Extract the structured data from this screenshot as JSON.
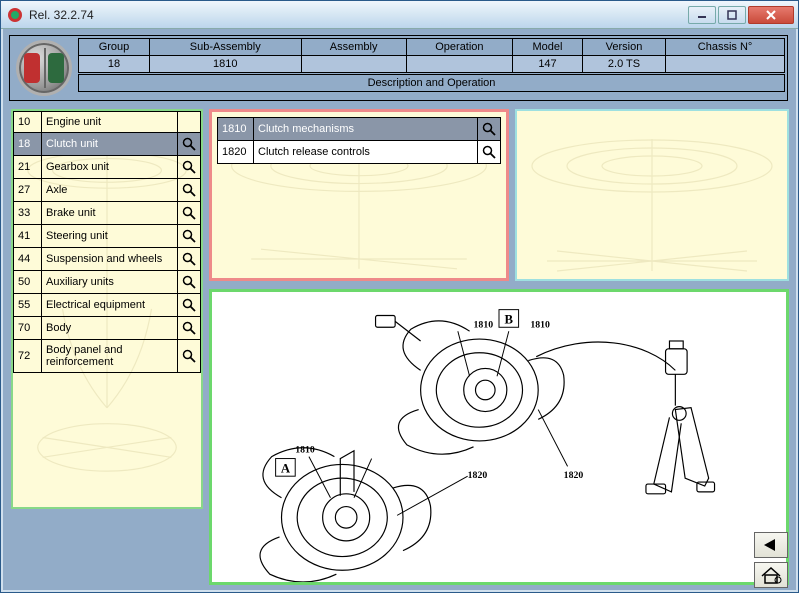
{
  "window": {
    "title": "Rel. 32.2.74"
  },
  "header": {
    "cols": {
      "group": "Group",
      "sub_assembly": "Sub-Assembly",
      "assembly": "Assembly",
      "operation": "Operation",
      "model": "Model",
      "version": "Version",
      "chassis": "Chassis N°"
    },
    "vals": {
      "group": "18",
      "sub_assembly": "1810",
      "assembly": "",
      "operation": "",
      "model": "147",
      "version": "2.0 TS",
      "chassis": ""
    },
    "desc_row": "Description and Operation"
  },
  "groups": [
    {
      "num": "10",
      "label": "Engine unit",
      "mag": false,
      "selected": false
    },
    {
      "num": "18",
      "label": "Clutch unit",
      "mag": true,
      "selected": true
    },
    {
      "num": "21",
      "label": "Gearbox unit",
      "mag": true,
      "selected": false
    },
    {
      "num": "27",
      "label": "Axle",
      "mag": true,
      "selected": false
    },
    {
      "num": "33",
      "label": "Brake unit",
      "mag": true,
      "selected": false
    },
    {
      "num": "41",
      "label": "Steering unit",
      "mag": true,
      "selected": false
    },
    {
      "num": "44",
      "label": "Suspension and wheels",
      "mag": true,
      "selected": false
    },
    {
      "num": "50",
      "label": "Auxiliary units",
      "mag": true,
      "selected": false
    },
    {
      "num": "55",
      "label": "Electrical equipment",
      "mag": true,
      "selected": false
    },
    {
      "num": "70",
      "label": "Body",
      "mag": true,
      "selected": false
    },
    {
      "num": "72",
      "label": "Body panel and reinforcement",
      "mag": true,
      "selected": false
    }
  ],
  "sub_assemblies": [
    {
      "num": "1810",
      "label": "Clutch mechanisms",
      "selected": true
    },
    {
      "num": "1820",
      "label": "Clutch release controls",
      "selected": false
    }
  ],
  "diagram": {
    "callouts": {
      "A": "A",
      "B": "B",
      "n1810a": "1810",
      "n1810b": "1810",
      "n1820a": "1820",
      "n1820b": "1820"
    }
  },
  "icons": {
    "magnify": "magnify-icon",
    "back": "back-icon",
    "home": "home-icon"
  }
}
